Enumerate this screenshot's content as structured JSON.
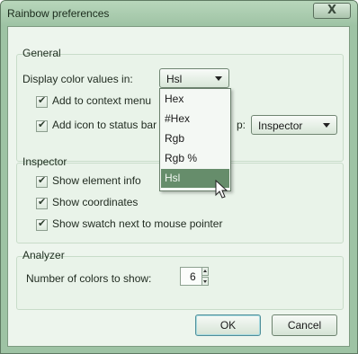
{
  "window": {
    "title": "Rainbow preferences",
    "close_glyph": "X"
  },
  "general": {
    "label": "General",
    "display_label": "Display color values in:",
    "display_value": "Hsl",
    "context_menu_label": "Add to context menu",
    "status_bar_label": "Add icon to status bar",
    "status_bar_suffix": "p:",
    "status_bar_value": "Inspector",
    "options": [
      "Hex",
      "#Hex",
      "Rgb",
      "Rgb %",
      "Hsl"
    ]
  },
  "inspector": {
    "label": "Inspector",
    "show_element_info": "Show element info",
    "show_coordinates": "Show coordinates",
    "show_swatch": "Show swatch next to mouse pointer"
  },
  "analyzer": {
    "label": "Analyzer",
    "num_colors_label": "Number of colors to show:",
    "num_colors_value": "6"
  },
  "buttons": {
    "ok": "OK",
    "cancel": "Cancel"
  },
  "colors": {
    "title_bar": "#9ec3a4",
    "client_bg": "#edf5ed",
    "selected": "#668d6b"
  },
  "icons": {
    "close": "close-icon",
    "dropdown": "chevron-down-icon",
    "cursor": "pointer-cursor-icon"
  }
}
